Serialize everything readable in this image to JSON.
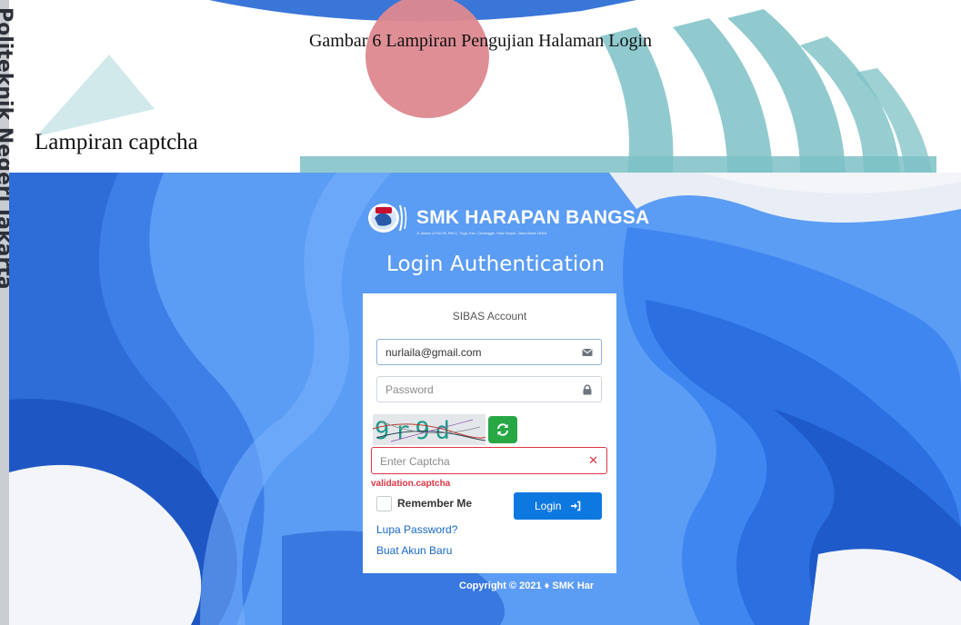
{
  "document": {
    "caption": "Gambar 6 Lampiran Pengujian Halaman Login",
    "section_title": "Lampiran captcha",
    "side_stamp": "Politeknik Negeri Jakarta"
  },
  "app": {
    "brand_name": "SMK HARAPAN BANGSA",
    "brand_address": "Jl. Akses UI No.95, RW 1, Tugu, Kec. Cimanggis, Kota Depok, Jawa Barat 16451",
    "page_heading": "Login Authentication",
    "copyright": "Copyright © 2021 ♦ SMK Har"
  },
  "login_card": {
    "title": "SIBAS Account",
    "email_value": "nurlaila@gmail.com",
    "password_placeholder": "Password",
    "captcha_text": "9r9d",
    "captcha_placeholder": "Enter Captcha",
    "captcha_error": "validation.captcha",
    "remember_label": "Remember Me",
    "login_label": "Login",
    "forgot_password_link": "Lupa Password?",
    "register_link": "Buat Akun Baru"
  },
  "colors": {
    "background_blue": "#4a8ff2",
    "primary_button": "#0d78e0",
    "refresh_button": "#28a745",
    "error": "#dc3545",
    "link": "#1769c7"
  },
  "icons": {
    "email_field": "envelope-icon",
    "password_field": "lock-icon",
    "captcha_refresh": "refresh-icon",
    "captcha_error": "close-icon",
    "login_button": "sign-in-icon"
  }
}
